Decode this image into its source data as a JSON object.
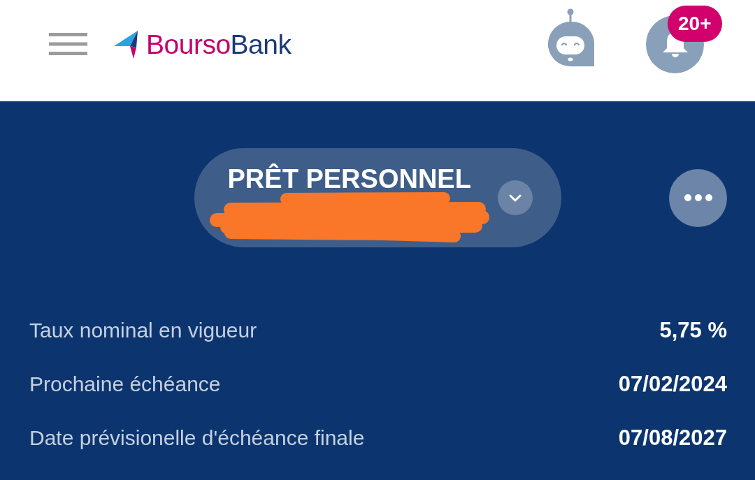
{
  "header": {
    "logo": {
      "wordmark_first": "Bourso",
      "wordmark_second": "Bank"
    },
    "notifications_badge": "20+"
  },
  "loan_selector": {
    "title": "PRÊT PERSONNEL"
  },
  "details": [
    {
      "label": "Taux nominal en vigueur",
      "value": "5,75 %"
    },
    {
      "label": "Prochaine échéance",
      "value": "07/02/2024"
    },
    {
      "label": "Date prévisionelle d'échéance finale",
      "value": "07/08/2027"
    }
  ]
}
